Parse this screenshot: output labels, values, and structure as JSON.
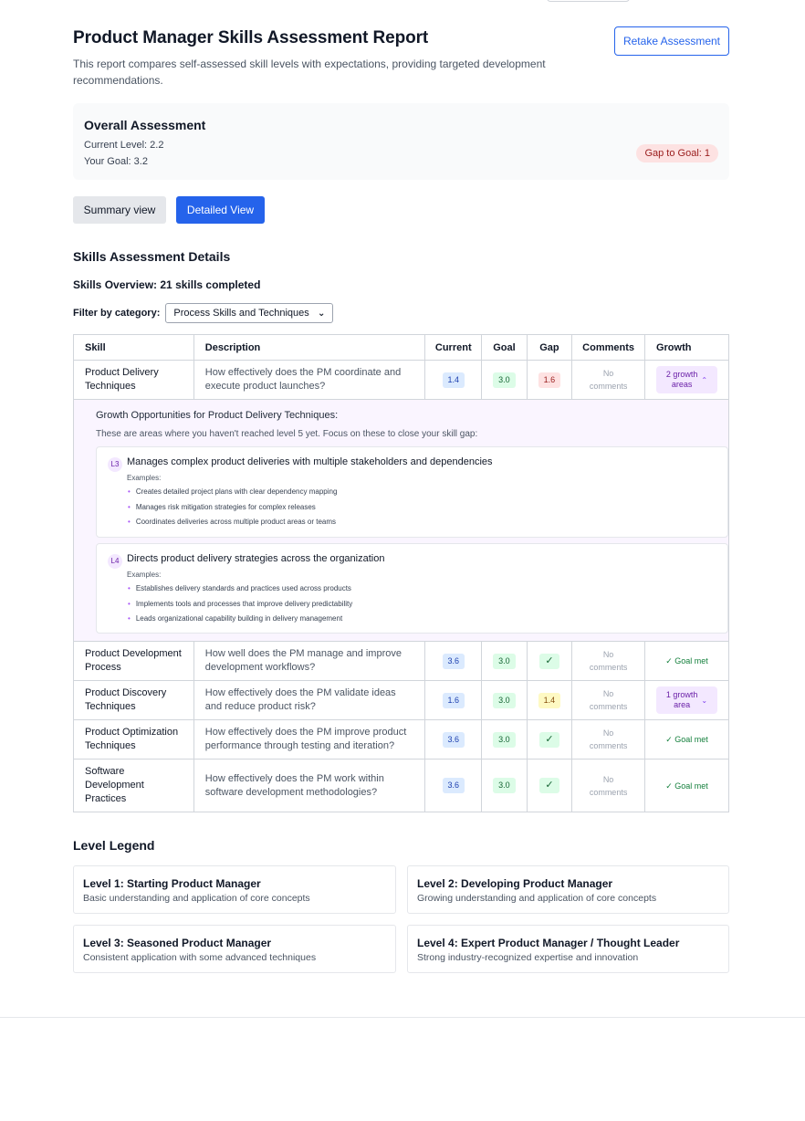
{
  "header": {
    "title": "Product Manager Skills Assessment Report",
    "subtitle": "This report compares self-assessed skill levels with expectations, providing targeted development recommendations.",
    "retake_label": "Retake Assessment"
  },
  "overall": {
    "title": "Overall Assessment",
    "current_label": "Current Level:",
    "current_value": "2.2",
    "goal_label": "Your Goal:",
    "goal_value": "3.2",
    "gap_badge": "Gap to Goal: 1"
  },
  "views": {
    "summary_label": "Summary view",
    "detailed_label": "Detailed View"
  },
  "details": {
    "section_title": "Skills Assessment Details",
    "overview": "Skills Overview: 21 skills completed",
    "filter_label": "Filter by category:",
    "filter_value": "Process Skills and Techniques"
  },
  "table": {
    "headers": [
      "Skill",
      "Description",
      "Current",
      "Goal",
      "Gap",
      "Comments",
      "Growth"
    ],
    "no_comments_line1": "No",
    "no_comments_line2": "comments",
    "goal_met_label": "✓ Goal met",
    "check_mark": "✓",
    "rows": [
      {
        "skill": "Product Delivery Techniques",
        "description": "How effectively does the PM coordinate and execute product launches?",
        "current": "1.4",
        "goal": "3.0",
        "gap": "1.6",
        "growth_line1": "2 growth",
        "growth_line2": "areas"
      },
      {
        "skill": "Product Development Process",
        "description": "How well does the PM manage and improve development workflows?",
        "current": "3.6",
        "goal": "3.0"
      },
      {
        "skill": "Product Discovery Techniques",
        "description": "How effectively does the PM validate ideas and reduce product risk?",
        "current": "1.6",
        "goal": "3.0",
        "gap": "1.4",
        "growth_line1": "1 growth",
        "growth_line2": "area"
      },
      {
        "skill": "Product Optimization Techniques",
        "description": "How effectively does the PM improve product performance through testing and iteration?",
        "current": "3.6",
        "goal": "3.0"
      },
      {
        "skill": "Software Development Practices",
        "description": "How effectively does the PM work within software development methodologies?",
        "current": "3.6",
        "goal": "3.0"
      }
    ]
  },
  "growth_panel": {
    "title": "Growth Opportunities for Product Delivery Techniques:",
    "subtitle": "These are areas where you haven't reached level 5 yet. Focus on these to close your skill gap:",
    "examples_label": "Examples:",
    "opportunities": [
      {
        "level": "L3",
        "title": "Manages complex product deliveries with multiple stakeholders and dependencies",
        "examples": [
          "Creates detailed project plans with clear dependency mapping",
          "Manages risk mitigation strategies for complex releases",
          "Coordinates deliveries across multiple product areas or teams"
        ]
      },
      {
        "level": "L4",
        "title": "Directs product delivery strategies across the organization",
        "examples": [
          "Establishes delivery standards and practices used across products",
          "Implements tools and processes that improve delivery predictability",
          "Leads organizational capability building in delivery management"
        ]
      }
    ]
  },
  "legend": {
    "title": "Level Legend",
    "levels": [
      {
        "name": "Level 1: Starting Product Manager",
        "desc": "Basic understanding and application of core concepts"
      },
      {
        "name": "Level 2: Developing Product Manager",
        "desc": "Growing understanding and application of core concepts"
      },
      {
        "name": "Level 3: Seasoned Product Manager",
        "desc": "Consistent application with some advanced techniques"
      },
      {
        "name": "Level 4: Expert Product Manager / Thought Leader",
        "desc": "Strong industry-recognized expertise and innovation"
      }
    ]
  },
  "colors": {
    "accent": "#2563eb",
    "gap_badge_bg": "#fde2e2",
    "growth_bg": "#f3e8ff",
    "goal_met": "#15803d"
  },
  "icons": {
    "chevron_up": "⌃",
    "chevron_down": "⌄",
    "select_chevron": "⌄"
  }
}
